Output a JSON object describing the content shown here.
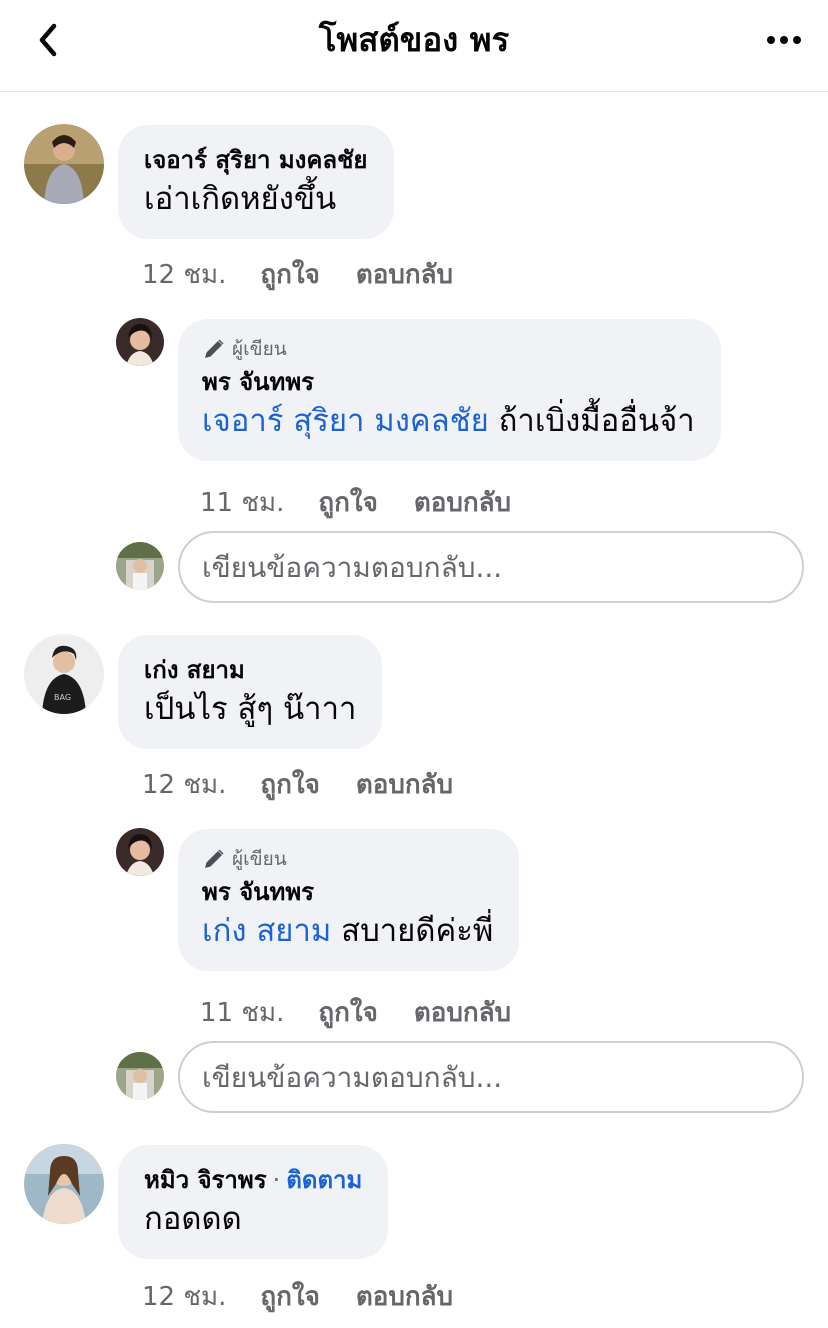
{
  "header": {
    "title": "โพสต์ของ พร",
    "back_icon": "chevron-left-icon",
    "more_icon": "more-horizontal-icon"
  },
  "author_tag": "ผู้เขียน",
  "reply_placeholder": "เขียนข้อความตอบกลับ...",
  "comments": [
    {
      "name": "เจอาร์ สุริยา มงคลชัย",
      "text": "เอ่าเกิดหยังขึ้น",
      "time": "12 ชม.",
      "like": "ถูกใจ",
      "reply": "ตอบกลับ",
      "author_reply": {
        "name": "พร จันทพร",
        "mention": "เจอาร์ สุริยา มงคลชัย",
        "text": " ถ้าเบิ่งมื้ออื่นจ้า",
        "time": "11 ชม.",
        "like": "ถูกใจ",
        "reply": "ตอบกลับ"
      }
    },
    {
      "name": "เก่ง สยาม",
      "text": "เป็นไร สู้ๆ น๊าาา",
      "time": "12 ชม.",
      "like": "ถูกใจ",
      "reply": "ตอบกลับ",
      "author_reply": {
        "name": "พร จันทพร",
        "mention": "เก่ง สยาม",
        "text": " สบายดีค่ะพี่",
        "time": "11 ชม.",
        "like": "ถูกใจ",
        "reply": "ตอบกลับ"
      }
    },
    {
      "name": "หมิว จิราพร",
      "separator": "·",
      "follow": "ติดตาม",
      "text": "กอดดด",
      "time": "12 ชม.",
      "like": "ถูกใจ",
      "reply": "ตอบกลับ"
    }
  ],
  "colors": {
    "link": "#1b63d4",
    "bubble": "#f0f2f5",
    "meta": "#65676b"
  }
}
